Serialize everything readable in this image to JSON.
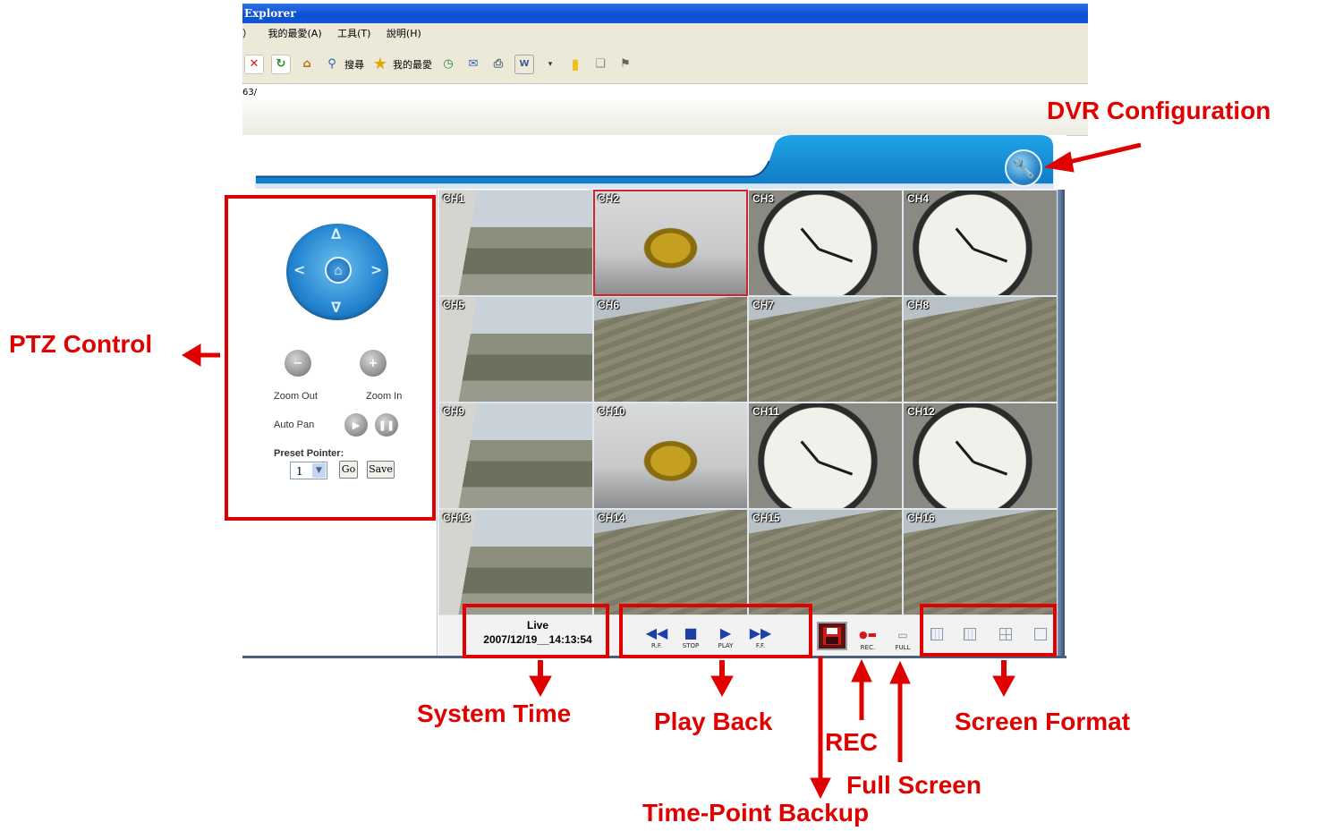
{
  "browser": {
    "title": "Explorer",
    "menu": [
      "）",
      "我的最愛(A)",
      "工具(T)",
      "說明(H)"
    ],
    "toolbar_labels": {
      "search": "搜尋",
      "favorites": "我的最愛"
    },
    "address": "63/"
  },
  "grid": {
    "channels": [
      "CH1",
      "CH2",
      "CH3",
      "CH4",
      "CH5",
      "CH6",
      "CH7",
      "CH8",
      "CH9",
      "CH10",
      "CH11",
      "CH12",
      "CH13",
      "CH14",
      "CH15",
      "CH16"
    ],
    "selected_channel": "CH2"
  },
  "ptz": {
    "zoom_out": "Zoom Out",
    "zoom_in": "Zoom In",
    "auto_pan": "Auto Pan",
    "preset_pointer": "Preset Pointer:",
    "preset_value": "1",
    "go": "Go",
    "save": "Save"
  },
  "status": {
    "mode": "Live",
    "time": "2007/12/19__14:13:54"
  },
  "playback": {
    "rf": "R.F.",
    "stop": "STOP",
    "play": "PLAY",
    "ff": "F.F."
  },
  "record": {
    "rec": "REC.",
    "full": "FULL"
  },
  "annotations": {
    "dvr_config": "DVR Configuration",
    "ptz_control": "PTZ Control",
    "system_time": "System Time",
    "play_back": "Play Back",
    "rec": "REC",
    "full_screen": "Full Screen",
    "screen_format": "Screen Format",
    "time_point_backup": "Time-Point Backup"
  },
  "colors": {
    "annotation": "#e00000",
    "accent_blue": "#1a8ad4"
  }
}
